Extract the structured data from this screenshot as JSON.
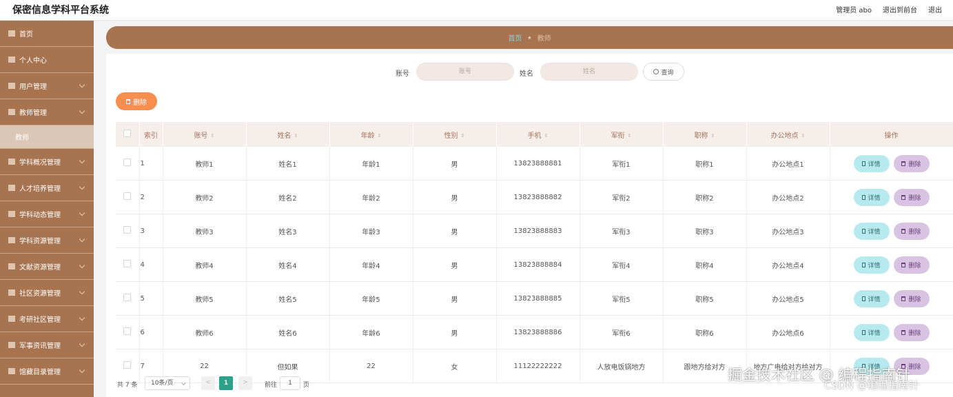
{
  "header": {
    "title": "保密信息学科平台系统",
    "admin_label": "管理员 abo",
    "back_to_front": "退出到前台",
    "logout": "退出"
  },
  "sidebar": {
    "items": [
      {
        "label": "首页",
        "icon": "home-icon"
      },
      {
        "label": "个人中心",
        "icon": "user-icon"
      },
      {
        "label": "用户管理",
        "icon": "users-icon"
      },
      {
        "label": "教师管理",
        "icon": "teacher-icon"
      },
      {
        "label": "学科概况管理",
        "icon": "book-icon"
      },
      {
        "label": "人才培养管理",
        "icon": "talent-icon"
      },
      {
        "label": "学科动态管理",
        "icon": "news-icon"
      },
      {
        "label": "学科资源管理",
        "icon": "resource-icon"
      },
      {
        "label": "文献资源管理",
        "icon": "document-icon"
      },
      {
        "label": "社区资源管理",
        "icon": "community-icon"
      },
      {
        "label": "考研社区管理",
        "icon": "grid-icon"
      },
      {
        "label": "军事资讯管理",
        "icon": "chart-icon"
      },
      {
        "label": "馆藏目录管理",
        "icon": "catalog-icon"
      }
    ],
    "active_sub": "教师"
  },
  "breadcrumb": {
    "home": "首页",
    "current": "教师"
  },
  "search": {
    "account_label": "账号",
    "account_placeholder": "账号",
    "name_label": "姓名",
    "name_placeholder": "姓名",
    "query_button": "查询"
  },
  "toolbar": {
    "delete_label": "删除"
  },
  "table": {
    "headers": [
      "索引",
      "账号",
      "姓名",
      "年龄",
      "性别",
      "手机",
      "军衔",
      "职称",
      "办公地点",
      "操作"
    ],
    "rows": [
      [
        "1",
        "教师1",
        "姓名1",
        "年龄1",
        "男",
        "13823888881",
        "军衔1",
        "职称1",
        "办公地点1"
      ],
      [
        "2",
        "教师2",
        "姓名2",
        "年龄2",
        "男",
        "13823888882",
        "军衔2",
        "职称2",
        "办公地点2"
      ],
      [
        "3",
        "教师3",
        "姓名3",
        "年龄3",
        "男",
        "13823888883",
        "军衔3",
        "职称3",
        "办公地点3"
      ],
      [
        "4",
        "教师4",
        "姓名4",
        "年龄4",
        "男",
        "13823888884",
        "军衔4",
        "职称4",
        "办公地点4"
      ],
      [
        "5",
        "教师5",
        "姓名5",
        "年龄5",
        "男",
        "13823888885",
        "军衔5",
        "职称5",
        "办公地点5"
      ],
      [
        "6",
        "教师6",
        "姓名6",
        "年龄6",
        "男",
        "13823888886",
        "军衔6",
        "职称6",
        "办公地点6"
      ],
      [
        "7",
        "22",
        "但如果",
        "22",
        "女",
        "11122222222",
        "人放电饭锅地方",
        "跟地方给对方",
        "地方广电给对方给对方"
      ]
    ],
    "detail_label": "详情",
    "delete_label": "删除"
  },
  "pagination": {
    "total": "共 7 条",
    "page_size": "10条/页",
    "prev": "<",
    "current_page": "1",
    "next": ">",
    "goto_label": "前往",
    "goto_value": "1",
    "page_unit": "页"
  },
  "watermark": {
    "line1": "掘金技术社区 @ 编程指南针",
    "line2": "CSDN @编程指南针"
  },
  "colors": {
    "sidebar_bg": "#a8734f",
    "delete_orange": "#f78e4f",
    "detail_cyan": "#b7eaee",
    "delete_purple": "#d9c3e3",
    "page_active": "#2aa38a"
  }
}
